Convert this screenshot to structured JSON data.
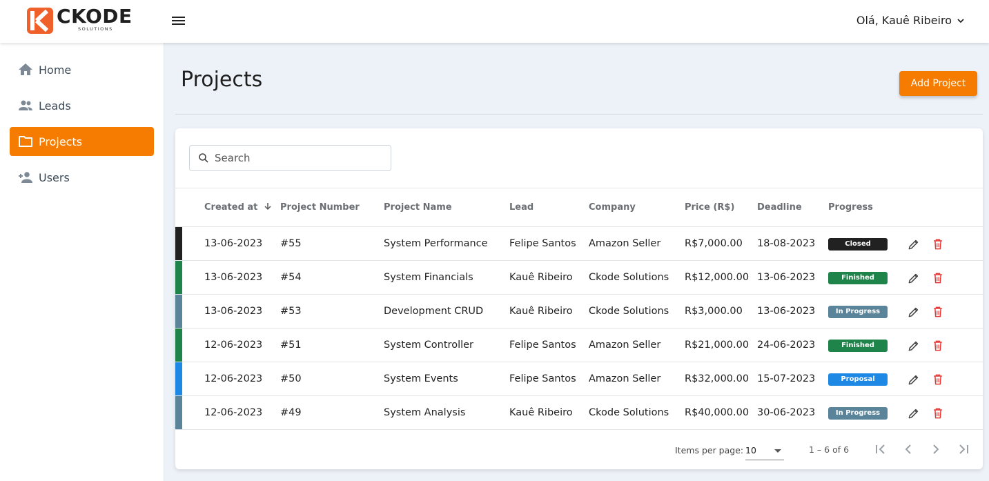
{
  "header": {
    "logo_word": "CKODE",
    "logo_sub": "SOLUTIONS",
    "greeting": "Olá, Kauê Ribeiro"
  },
  "sidebar": {
    "items": [
      {
        "label": "Home",
        "icon": "home-icon"
      },
      {
        "label": "Leads",
        "icon": "people-icon"
      },
      {
        "label": "Projects",
        "icon": "folder-icon",
        "active": true
      },
      {
        "label": "Users",
        "icon": "person-add-icon"
      }
    ]
  },
  "page": {
    "title": "Projects",
    "add_button": "Add Project"
  },
  "search": {
    "placeholder": "Search"
  },
  "table": {
    "columns": [
      "Created at",
      "Project Number",
      "Project Name",
      "Lead",
      "Company",
      "Price (R$)",
      "Deadline",
      "Progress"
    ],
    "rows": [
      {
        "created": "13-06-2023",
        "number": "#55",
        "name": "System Performance",
        "lead": "Felipe Santos",
        "company": "Amazon Seller",
        "price": "R$7,000.00",
        "deadline": "18-08-2023",
        "progress": "Closed"
      },
      {
        "created": "13-06-2023",
        "number": "#54",
        "name": "System Financials",
        "lead": "Kauê Ribeiro",
        "company": "Ckode Solutions",
        "price": "R$12,000.00",
        "deadline": "13-06-2023",
        "progress": "Finished"
      },
      {
        "created": "13-06-2023",
        "number": "#53",
        "name": "Development CRUD",
        "lead": "Kauê Ribeiro",
        "company": "Ckode Solutions",
        "price": "R$3,000.00",
        "deadline": "13-06-2023",
        "progress": "In Progress"
      },
      {
        "created": "12-06-2023",
        "number": "#51",
        "name": "System Controller",
        "lead": "Felipe Santos",
        "company": "Amazon Seller",
        "price": "R$21,000.00",
        "deadline": "24-06-2023",
        "progress": "Finished"
      },
      {
        "created": "12-06-2023",
        "number": "#50",
        "name": "System Events",
        "lead": "Felipe Santos",
        "company": "Amazon Seller",
        "price": "R$32,000.00",
        "deadline": "15-07-2023",
        "progress": "Proposal"
      },
      {
        "created": "12-06-2023",
        "number": "#49",
        "name": "System Analysis",
        "lead": "Kauê Ribeiro",
        "company": "Ckode Solutions",
        "price": "R$40,000.00",
        "deadline": "30-06-2023",
        "progress": "In Progress"
      }
    ]
  },
  "status_colors": {
    "Closed": "#212121",
    "Finished": "#1e8449",
    "In Progress": "#5a8499",
    "Proposal": "#1e88e5"
  },
  "accent_color": "#f57c00",
  "pagination": {
    "items_per_page_label": "Items per page:",
    "items_per_page_value": "10",
    "range": "1 – 6 of 6"
  }
}
